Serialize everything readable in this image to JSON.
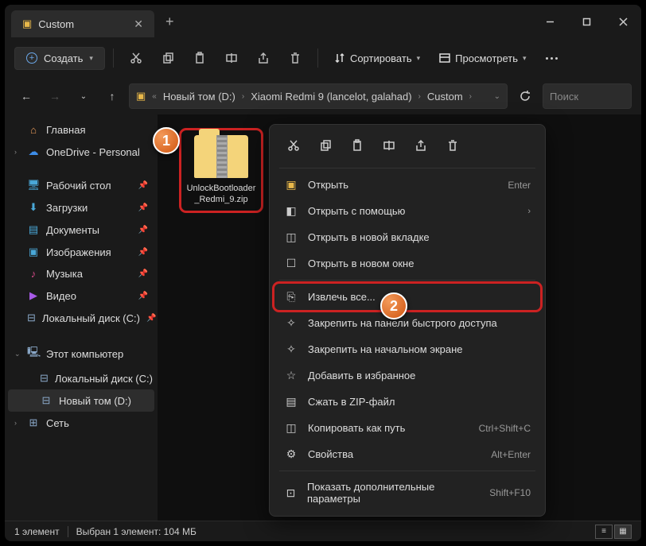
{
  "titlebar": {
    "tab_title": "Custom"
  },
  "toolbar": {
    "create_label": "Создать",
    "sort_label": "Сортировать",
    "view_label": "Просмотреть"
  },
  "breadcrumb": {
    "parts": [
      "Новый том (D:)",
      "Xiaomi Redmi 9 (lancelot, galahad)",
      "Custom"
    ]
  },
  "search": {
    "placeholder": "Поиск"
  },
  "sidebar": {
    "home": "Главная",
    "onedrive": "OneDrive - Personal",
    "desktop": "Рабочий стол",
    "downloads": "Загрузки",
    "documents": "Документы",
    "pictures": "Изображения",
    "music": "Музыка",
    "videos": "Видео",
    "localc": "Локальный диск (C:)",
    "thispc": "Этот компьютер",
    "localc2": "Локальный диск (C:)",
    "newvol": "Новый том (D:)",
    "network": "Сеть"
  },
  "file": {
    "name": "UnlockBootloader_Redmi_9.zip"
  },
  "ctx": {
    "open": "Открыть",
    "open_short": "Enter",
    "openwith": "Открыть с помощью",
    "opentab": "Открыть в новой вкладке",
    "openwin": "Открыть в новом окне",
    "extract": "Извлечь все...",
    "pinquick": "Закрепить на панели быстрого доступа",
    "pinstart": "Закрепить на начальном экране",
    "addfav": "Добавить в избранное",
    "compress": "Сжать в ZIP-файл",
    "copypath": "Копировать как путь",
    "copypath_short": "Ctrl+Shift+C",
    "props": "Свойства",
    "props_short": "Alt+Enter",
    "moreopts": "Показать дополнительные параметры",
    "moreopts_short": "Shift+F10"
  },
  "status": {
    "count": "1 элемент",
    "selected": "Выбран 1 элемент: 104 МБ"
  },
  "badges": {
    "one": "1",
    "two": "2"
  }
}
